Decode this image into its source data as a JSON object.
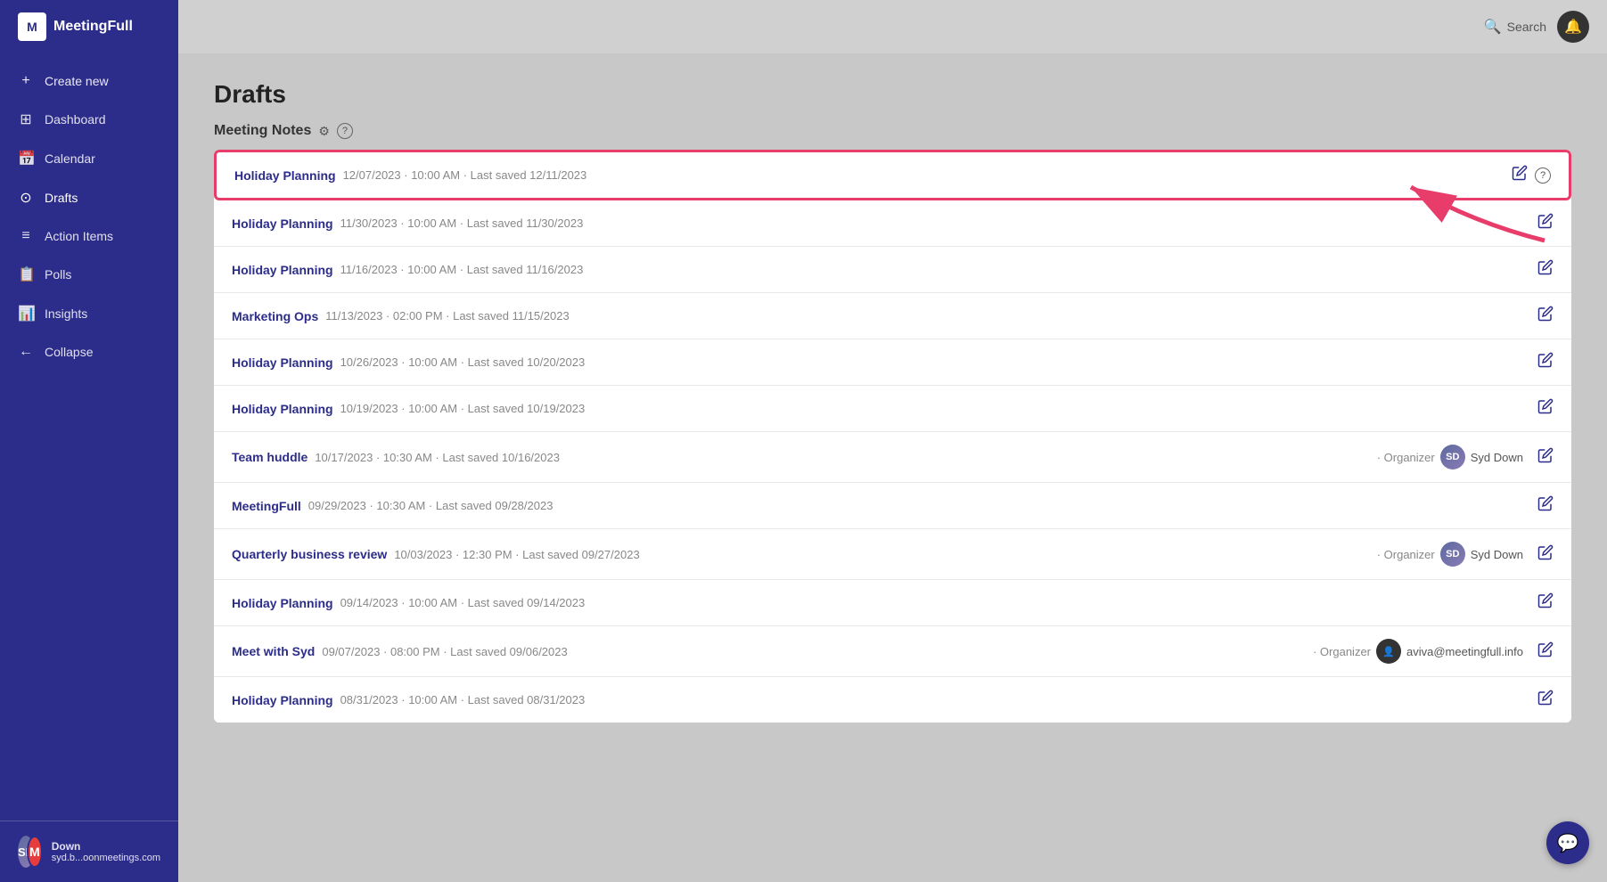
{
  "sidebar": {
    "logo_text": "MeetingFull",
    "items": [
      {
        "id": "create-new",
        "label": "Create new",
        "icon": "+"
      },
      {
        "id": "dashboard",
        "label": "Dashboard",
        "icon": "⊞"
      },
      {
        "id": "calendar",
        "label": "Calendar",
        "icon": "📅"
      },
      {
        "id": "drafts",
        "label": "Drafts",
        "icon": "⊙"
      },
      {
        "id": "action-items",
        "label": "Action Items",
        "icon": "≡"
      },
      {
        "id": "polls",
        "label": "Polls",
        "icon": "📋"
      },
      {
        "id": "insights",
        "label": "Insights",
        "icon": "📊"
      },
      {
        "id": "collapse",
        "label": "Collapse",
        "icon": "←"
      }
    ],
    "user": {
      "name": "Down",
      "email": "syd.b...oonmeetings.com"
    }
  },
  "topbar": {
    "search_placeholder": "Search",
    "notification_icon": "🔔"
  },
  "page": {
    "title": "Drafts",
    "section_title": "Meeting Notes"
  },
  "meetings": [
    {
      "name": "Holiday Planning",
      "date": "12/07/2023",
      "time": "10:00 AM",
      "last_saved": "Last saved 12/11/2023",
      "highlighted": true,
      "organizer": null
    },
    {
      "name": "Holiday Planning",
      "date": "11/30/2023",
      "time": "10:00 AM",
      "last_saved": "Last saved 11/30/2023",
      "highlighted": false,
      "organizer": null
    },
    {
      "name": "Holiday Planning",
      "date": "11/16/2023",
      "time": "10:00 AM",
      "last_saved": "Last saved 11/16/2023",
      "highlighted": false,
      "organizer": null
    },
    {
      "name": "Marketing Ops",
      "date": "11/13/2023",
      "time": "02:00 PM",
      "last_saved": "Last saved 11/15/2023",
      "highlighted": false,
      "organizer": null
    },
    {
      "name": "Holiday Planning",
      "date": "10/26/2023",
      "time": "10:00 AM",
      "last_saved": "Last saved 10/20/2023",
      "highlighted": false,
      "organizer": null
    },
    {
      "name": "Holiday Planning",
      "date": "10/19/2023",
      "time": "10:00 AM",
      "last_saved": "Last saved 10/19/2023",
      "highlighted": false,
      "organizer": null
    },
    {
      "name": "Team huddle",
      "date": "10/17/2023",
      "time": "10:30 AM",
      "last_saved": "Last saved 10/16/2023",
      "highlighted": false,
      "organizer": "Syd Down",
      "organizer_type": "syd"
    },
    {
      "name": "MeetingFull",
      "date": "09/29/2023",
      "time": "10:30 AM",
      "last_saved": "Last saved 09/28/2023",
      "highlighted": false,
      "organizer": null
    },
    {
      "name": "Quarterly business review",
      "date": "10/03/2023",
      "time": "12:30 PM",
      "last_saved": "Last saved 09/27/2023",
      "highlighted": false,
      "organizer": "Syd Down",
      "organizer_type": "syd"
    },
    {
      "name": "Holiday Planning",
      "date": "09/14/2023",
      "time": "10:00 AM",
      "last_saved": "Last saved 09/14/2023",
      "highlighted": false,
      "organizer": null
    },
    {
      "name": "Meet with Syd",
      "date": "09/07/2023",
      "time": "08:00 PM",
      "last_saved": "Last saved 09/06/2023",
      "highlighted": false,
      "organizer": "aviva@meetingfull.info",
      "organizer_type": "aviva"
    },
    {
      "name": "Holiday Planning",
      "date": "08/31/2023",
      "time": "10:00 AM",
      "last_saved": "Last saved 08/31/2023",
      "highlighted": false,
      "organizer": null
    }
  ]
}
